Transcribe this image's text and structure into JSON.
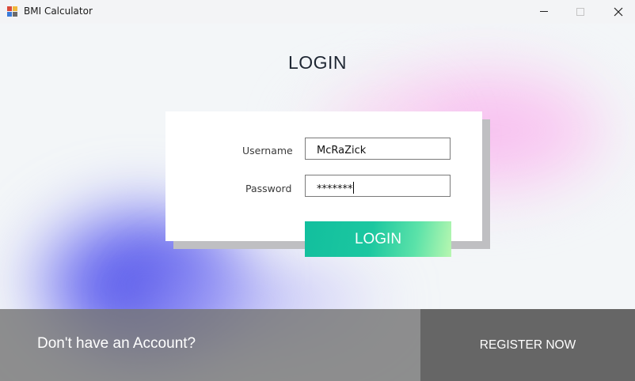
{
  "window": {
    "title": "BMI Calculator",
    "icon": "app-window-icon",
    "controls": {
      "minimize": "minimize-icon",
      "maximize": "maximize-icon",
      "close": "close-icon"
    }
  },
  "login": {
    "heading": "LOGIN",
    "username_label": "Username",
    "username_value": "McRaZick",
    "password_label": "Password",
    "password_value": "*******",
    "submit_label": "LOGIN"
  },
  "footer": {
    "prompt": "Don't have an Account?",
    "register_label": "REGISTER NOW"
  },
  "colors": {
    "accent_start": "#12bf9e",
    "accent_end": "#b8f7b0",
    "footer_bg": "#767676",
    "register_bg": "#666666",
    "blob_pink": "#f6b8ee",
    "blob_blue": "#4c4ee6"
  }
}
